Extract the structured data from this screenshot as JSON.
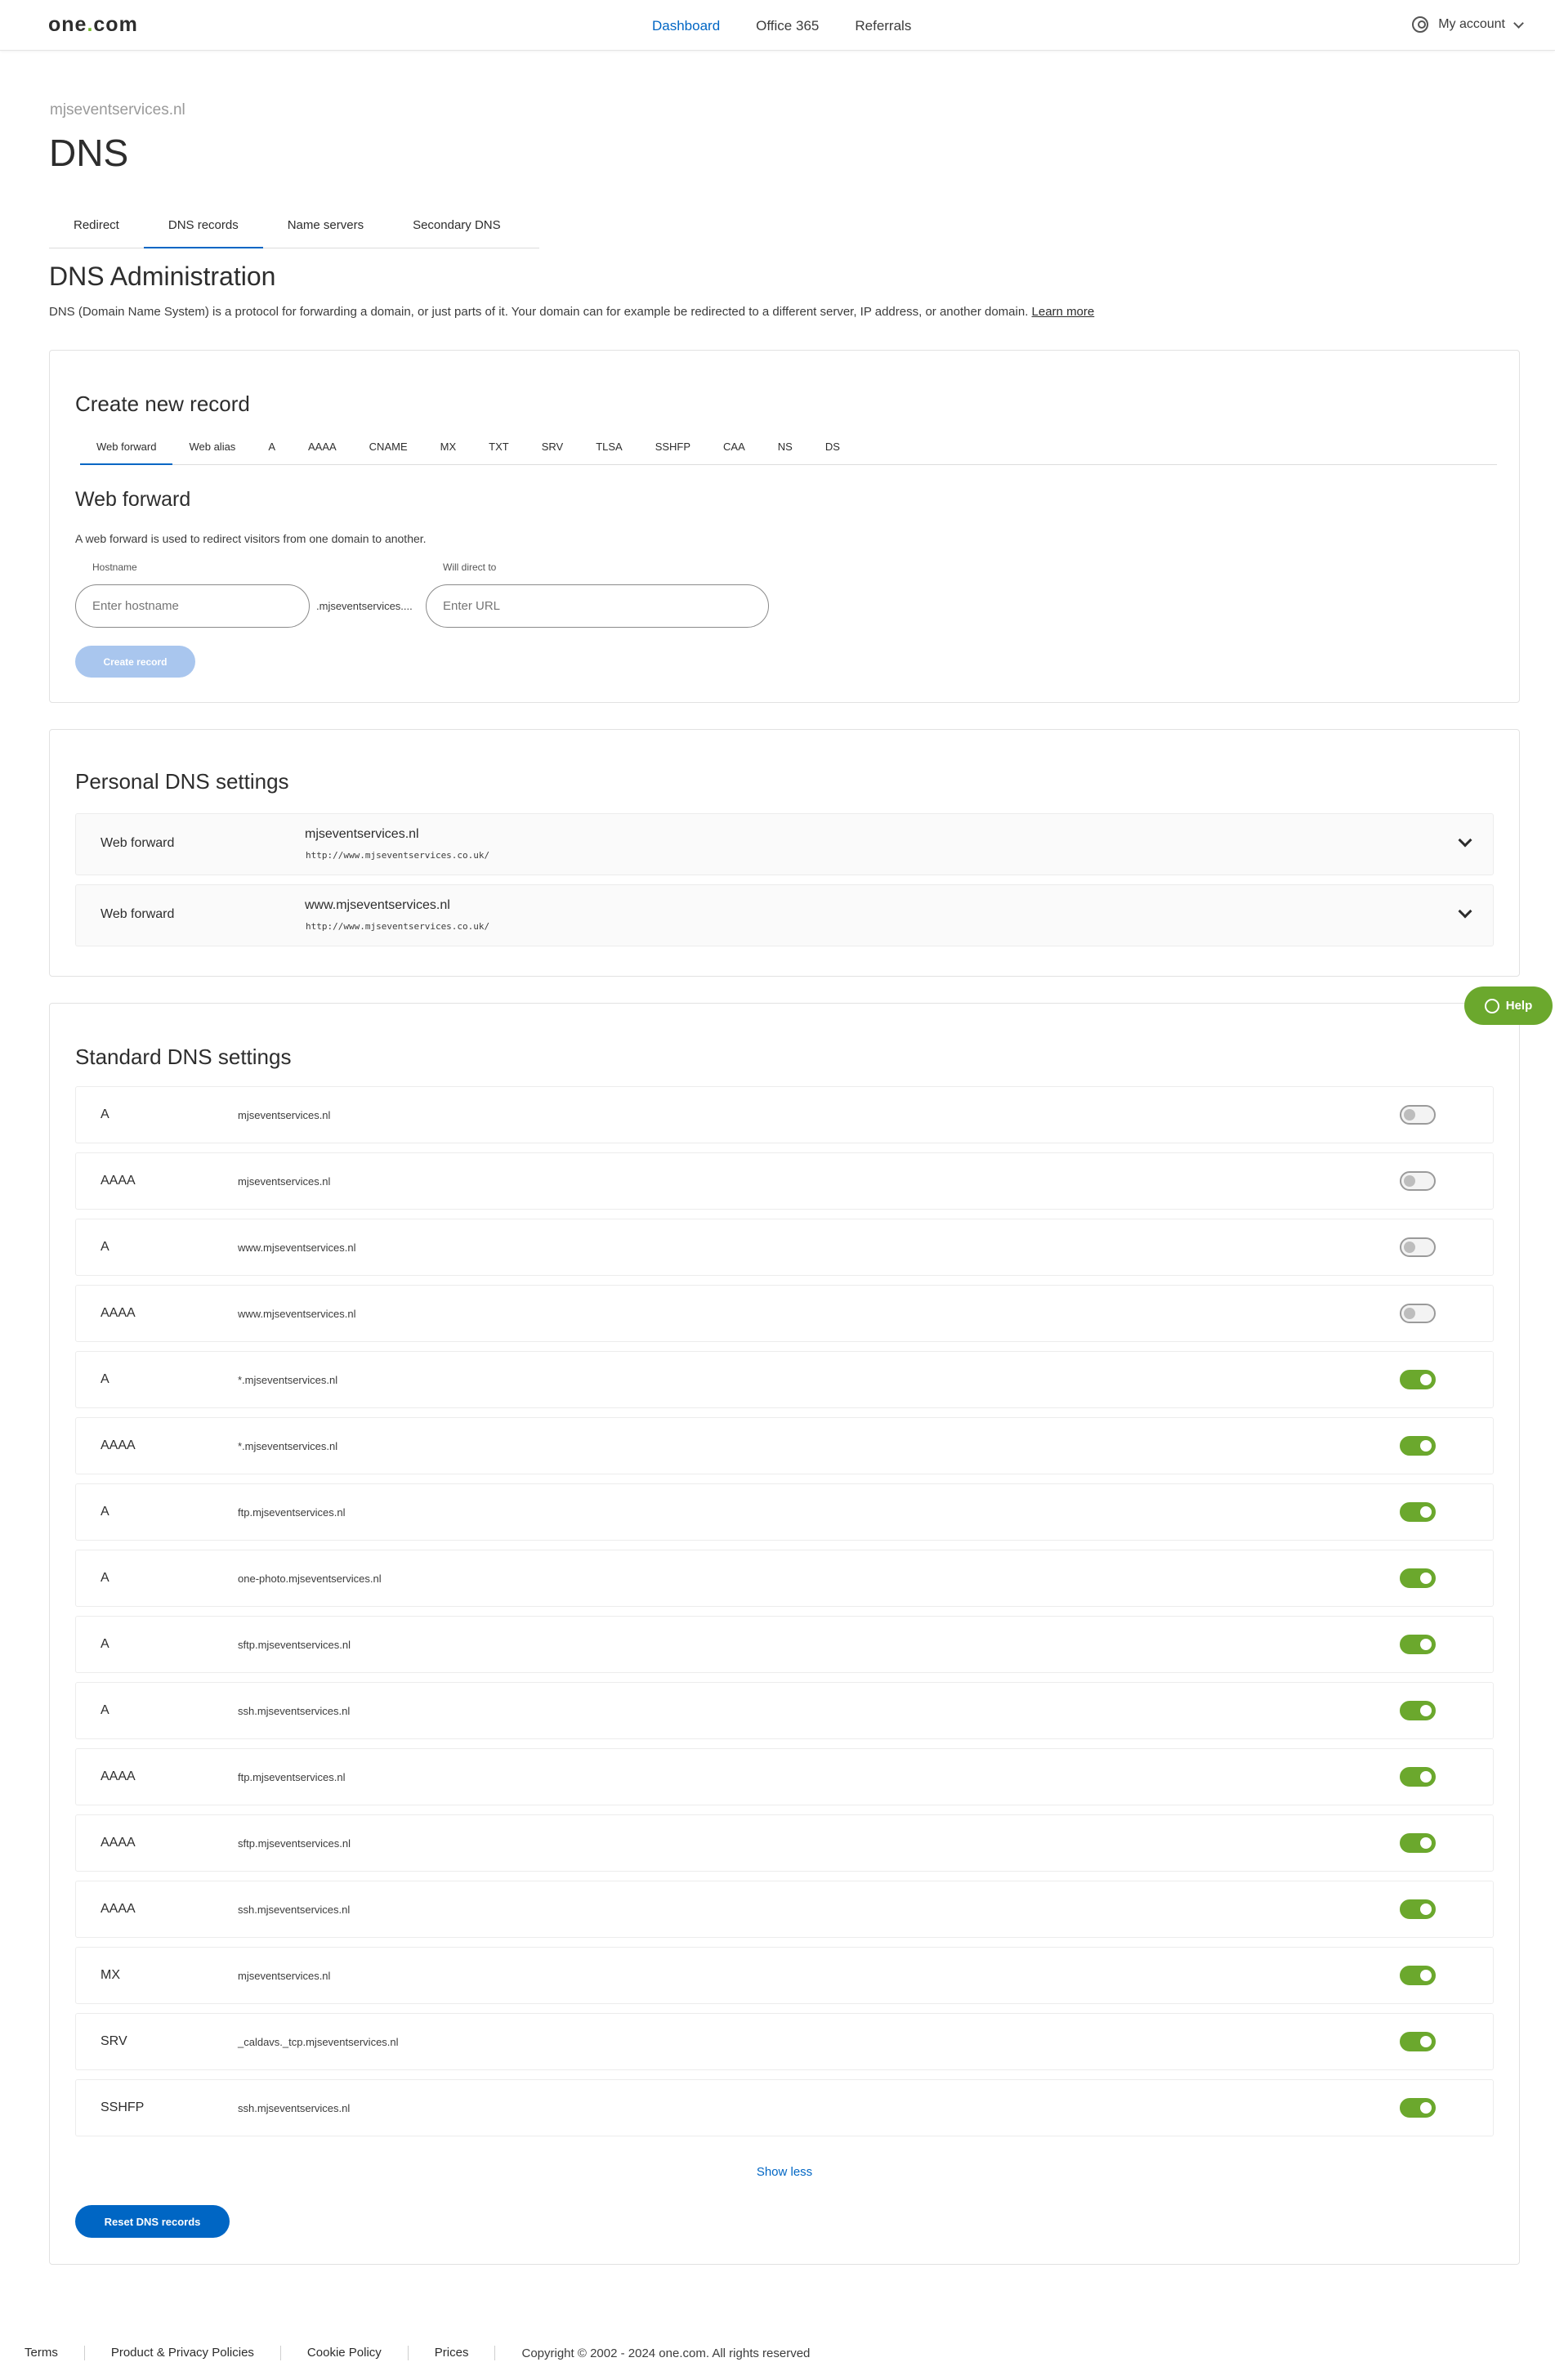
{
  "header": {
    "logo_text": "one",
    "logo_dot": ".",
    "logo_tld": "com",
    "nav": [
      {
        "label": "Dashboard",
        "active": true
      },
      {
        "label": "Office 365",
        "active": false
      },
      {
        "label": "Referrals",
        "active": false
      }
    ],
    "account_label": "My account"
  },
  "page": {
    "domain": "mjseventservices.nl",
    "title": "DNS",
    "tabs": [
      {
        "label": "Redirect",
        "active": false
      },
      {
        "label": "DNS records",
        "active": true
      },
      {
        "label": "Name servers",
        "active": false
      },
      {
        "label": "Secondary DNS",
        "active": false
      }
    ],
    "section_title": "DNS Administration",
    "description": "DNS (Domain Name System) is a protocol for forwarding a domain, or just parts of it. Your domain can for example be redirected to a different server, IP address, or another domain.",
    "learn_more": "Learn more"
  },
  "create": {
    "title": "Create new record",
    "record_tabs": [
      "Web forward",
      "Web alias",
      "A",
      "AAAA",
      "CNAME",
      "MX",
      "TXT",
      "SRV",
      "TLSA",
      "SSHFP",
      "CAA",
      "NS",
      "DS"
    ],
    "form_title": "Web forward",
    "form_desc": "A web forward is used to redirect visitors from one domain to another.",
    "hostname_label": "Hostname",
    "hostname_placeholder": "Enter hostname",
    "suffix": ".mjseventservices....",
    "direct_label": "Will direct to",
    "url_placeholder": "Enter URL",
    "button": "Create record"
  },
  "personal": {
    "title": "Personal DNS settings",
    "rows": [
      {
        "type": "Web forward",
        "host": "mjseventservices.nl",
        "url": "http://www.mjseventservices.co.uk/"
      },
      {
        "type": "Web forward",
        "host": "www.mjseventservices.nl",
        "url": "http://www.mjseventservices.co.uk/"
      }
    ]
  },
  "standard": {
    "title": "Standard DNS settings",
    "rows": [
      {
        "type": "A",
        "host": "mjseventservices.nl",
        "enabled": false
      },
      {
        "type": "AAAA",
        "host": "mjseventservices.nl",
        "enabled": false
      },
      {
        "type": "A",
        "host": "www.mjseventservices.nl",
        "enabled": false
      },
      {
        "type": "AAAA",
        "host": "www.mjseventservices.nl",
        "enabled": false
      },
      {
        "type": "A",
        "host": "*.mjseventservices.nl",
        "enabled": true
      },
      {
        "type": "AAAA",
        "host": "*.mjseventservices.nl",
        "enabled": true
      },
      {
        "type": "A",
        "host": "ftp.mjseventservices.nl",
        "enabled": true
      },
      {
        "type": "A",
        "host": "one-photo.mjseventservices.nl",
        "enabled": true
      },
      {
        "type": "A",
        "host": "sftp.mjseventservices.nl",
        "enabled": true
      },
      {
        "type": "A",
        "host": "ssh.mjseventservices.nl",
        "enabled": true
      },
      {
        "type": "AAAA",
        "host": "ftp.mjseventservices.nl",
        "enabled": true
      },
      {
        "type": "AAAA",
        "host": "sftp.mjseventservices.nl",
        "enabled": true
      },
      {
        "type": "AAAA",
        "host": "ssh.mjseventservices.nl",
        "enabled": true
      },
      {
        "type": "MX",
        "host": "mjseventservices.nl",
        "enabled": true
      },
      {
        "type": "SRV",
        "host": "_caldavs._tcp.mjseventservices.nl",
        "enabled": true
      },
      {
        "type": "SSHFP",
        "host": "ssh.mjseventservices.nl",
        "enabled": true
      }
    ],
    "show_less": "Show less",
    "reset_button": "Reset DNS records"
  },
  "help_label": "Help",
  "colors": {
    "accent": "#0066c4",
    "toggle_on": "#6ba82d",
    "disabled_button": "#a9c6ee"
  },
  "footer": {
    "links": [
      "Terms",
      "Product & Privacy Policies",
      "Cookie Policy",
      "Prices"
    ],
    "copyright": "Copyright © 2002 - 2024 one.com. All rights reserved"
  }
}
